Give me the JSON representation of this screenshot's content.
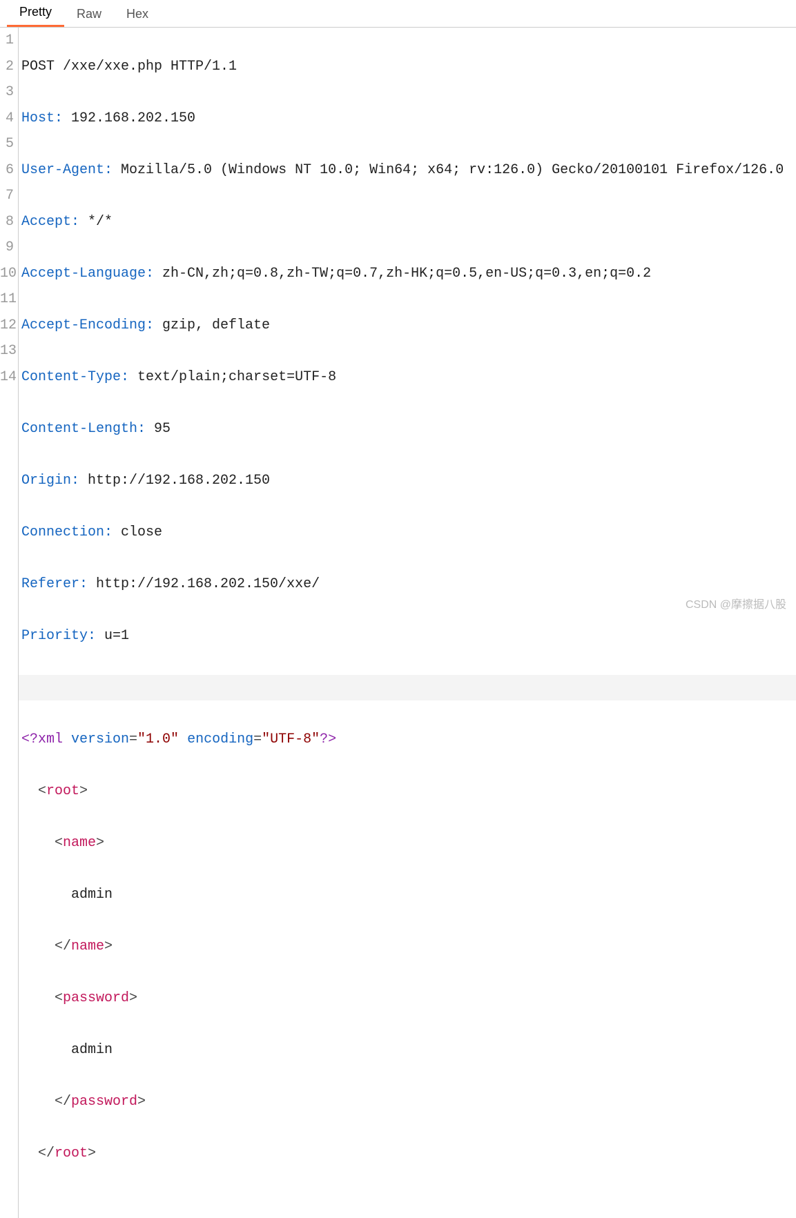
{
  "tabs": {
    "pretty": "Pretty",
    "raw": "Raw",
    "hex": "Hex"
  },
  "lines": [
    "1",
    "2",
    "3",
    "4",
    "5",
    "6",
    "7",
    "8",
    "9",
    "10",
    "11",
    "12",
    "13",
    "14"
  ],
  "request_line": "POST /xxe/xxe.php HTTP/1.1",
  "headers": {
    "host_k": "Host:",
    "host_v": " 192.168.202.150",
    "ua_k": "User-Agent:",
    "ua_v": " Mozilla/5.0 (Windows NT 10.0; Win64; x64; rv:126.0) Gecko/20100101 Firefox/126.0",
    "accept_k": "Accept:",
    "accept_v": " */*",
    "al_k": "Accept-Language:",
    "al_v": " zh-CN,zh;q=0.8,zh-TW;q=0.7,zh-HK;q=0.5,en-US;q=0.3,en;q=0.2",
    "ae_k": "Accept-Encoding:",
    "ae_v": " gzip, deflate",
    "ct_k": "Content-Type:",
    "ct_v": " text/plain;charset=UTF-8",
    "cl_k": "Content-Length:",
    "cl_v": " 95",
    "origin_k": "Origin:",
    "origin_v": " http://192.168.202.150",
    "conn_k": "Connection:",
    "conn_v": " close",
    "ref_k": "Referer:",
    "ref_v": " http://192.168.202.150/xxe/",
    "pri_k": "Priority:",
    "pri_v": " u=1"
  },
  "xml": {
    "pi_open": "<?xml",
    "ver_k": " version",
    "eq": "=",
    "ver_v": "\"1.0\"",
    "enc_k": " encoding",
    "enc_v": "\"UTF-8\"",
    "pi_close": "?>",
    "root_open_l": "  <",
    "root": "root",
    "root_open_r": ">",
    "name_open_l": "    <",
    "name": "name",
    "name_open_r": ">",
    "name_text": "      admin",
    "name_close_l": "    </",
    "name_close_r": ">",
    "pw_open_l": "    <",
    "password": "password",
    "pw_open_r": ">",
    "pw_text": "      admin",
    "pw_close_l": "    </",
    "pw_close_r": ">",
    "root_close_l": "  </",
    "root_close_r": ">"
  },
  "watermark": "CSDN @摩擦据八股"
}
